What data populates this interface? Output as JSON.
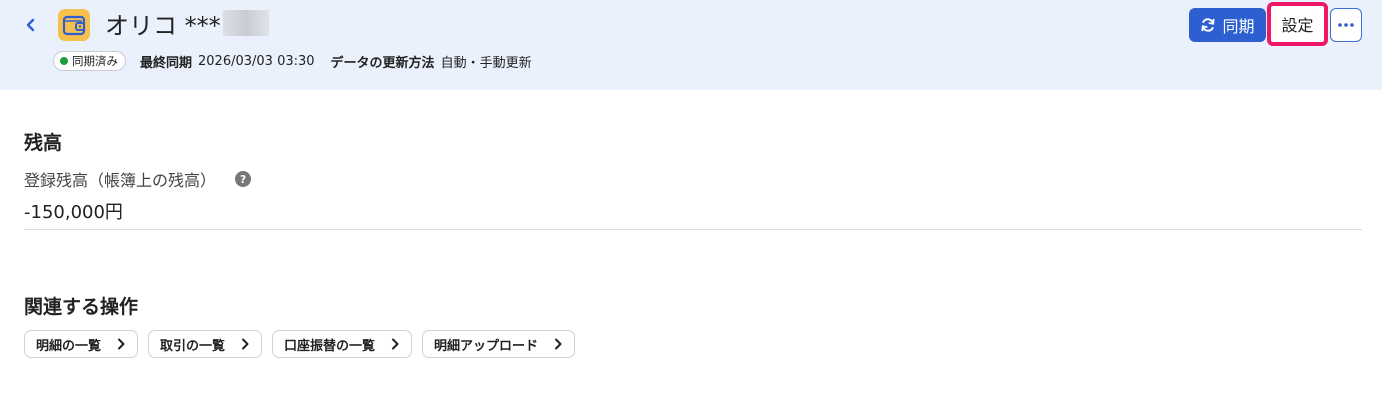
{
  "header": {
    "account_name": "オリコ ***",
    "sync_status": "同期済み",
    "last_sync_label": "最終同期",
    "last_sync_value": "2026/03/03 03:30",
    "update_method_label": "データの更新方法",
    "update_method_value": "自動・手動更新",
    "sync_button": "同期",
    "settings_button": "設定",
    "accent_color": "#2d5fd0",
    "highlight_color": "#ee1866"
  },
  "balance": {
    "section_title": "残高",
    "label": "登録残高（帳簿上の残高）",
    "help": "?",
    "value": "-150,000円"
  },
  "related": {
    "section_title": "関連する操作",
    "actions": [
      {
        "label": "明細の一覧"
      },
      {
        "label": "取引の一覧"
      },
      {
        "label": "口座振替の一覧"
      },
      {
        "label": "明細アップロード"
      }
    ]
  }
}
